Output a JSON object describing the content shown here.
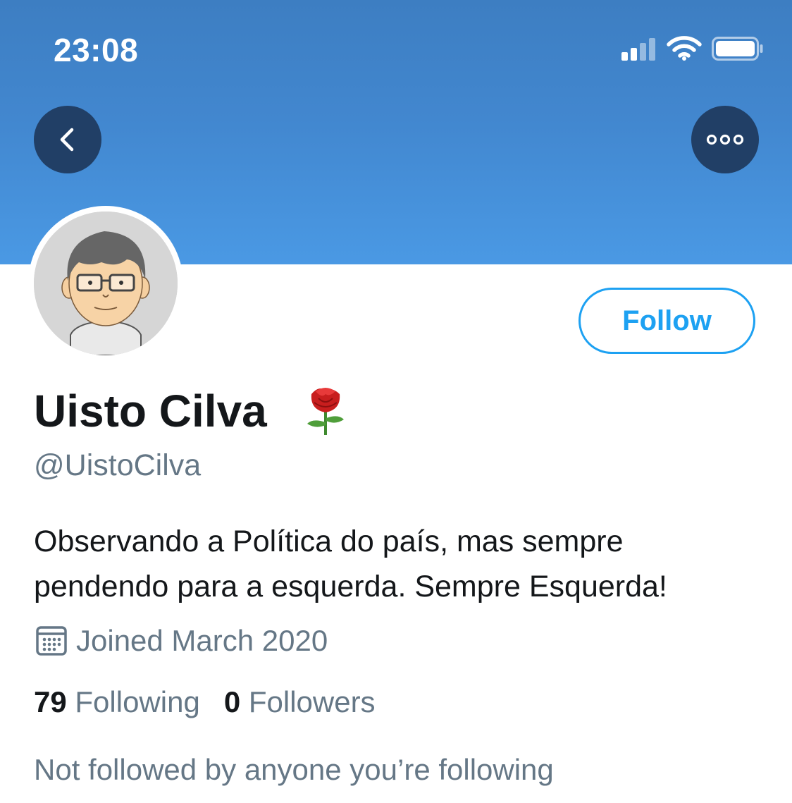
{
  "status_bar": {
    "time": "23:08",
    "icons": [
      "cellular-signal-icon",
      "wifi-icon",
      "battery-icon"
    ]
  },
  "header": {
    "back_icon": "chevron-left-icon",
    "more_icon": "more-horizontal-icon",
    "banner_color": "#4a99e4"
  },
  "profile": {
    "display_name": "Uisto Cilva",
    "name_emoji_icon": "rose-icon",
    "handle": "@UistoCilva",
    "bio_lines": [
      "Observando a Política do país, mas sempre",
      "pendendo para a esquerda. Sempre Esquerda!"
    ],
    "joined": "Joined March 2020",
    "following_count": "79",
    "following_label": "Following",
    "followers_count": "0",
    "followers_label": "Followers",
    "mutuals_note": "Not followed by anyone you’re following"
  },
  "actions": {
    "follow_label": "Follow"
  },
  "colors": {
    "accent": "#1da1f2",
    "secondary_text": "#657786",
    "primary_text": "#14171a"
  }
}
